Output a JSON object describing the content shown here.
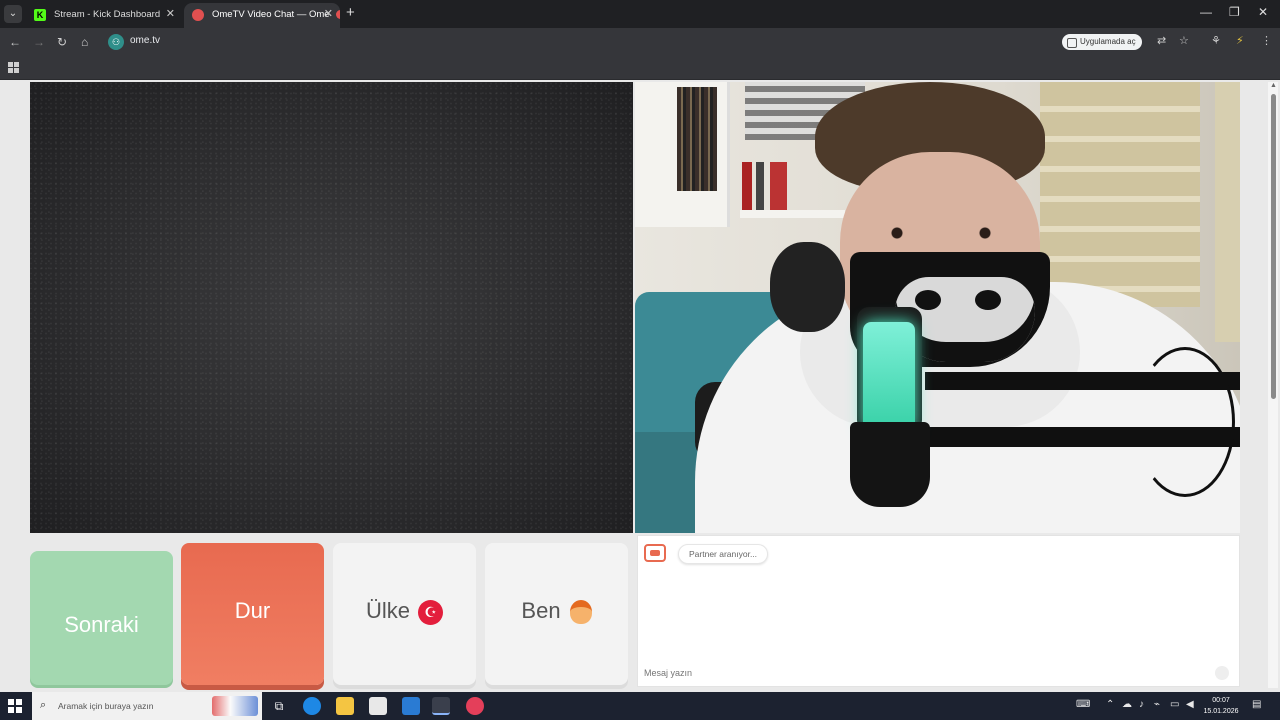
{
  "browser": {
    "tabs": [
      {
        "title": "Stream - Kick Dashboard",
        "favicon": "kick-icon",
        "active": false
      },
      {
        "title": "OmeTV Video Chat — Ome",
        "favicon": "ometv-icon",
        "active": true
      }
    ],
    "url": "ome.tv",
    "app_button_label": "Uygulamada aç",
    "favicon_letter": "K"
  },
  "controls": {
    "next_label": "Sonraki",
    "stop_label": "Dur",
    "country_label": "Ülke",
    "country_flag": "☪",
    "me_label": "Ben"
  },
  "chat": {
    "status": "Partner aranıyor...",
    "input_placeholder": "Mesaj yazın"
  },
  "taskbar": {
    "search_placeholder": "Aramak için buraya yazın",
    "time": "00:07",
    "date": "15.01.2026"
  },
  "colors": {
    "next": "#a3d8b0",
    "stop": "#ec7258",
    "accent_green_mic": "#4ff0c8"
  }
}
